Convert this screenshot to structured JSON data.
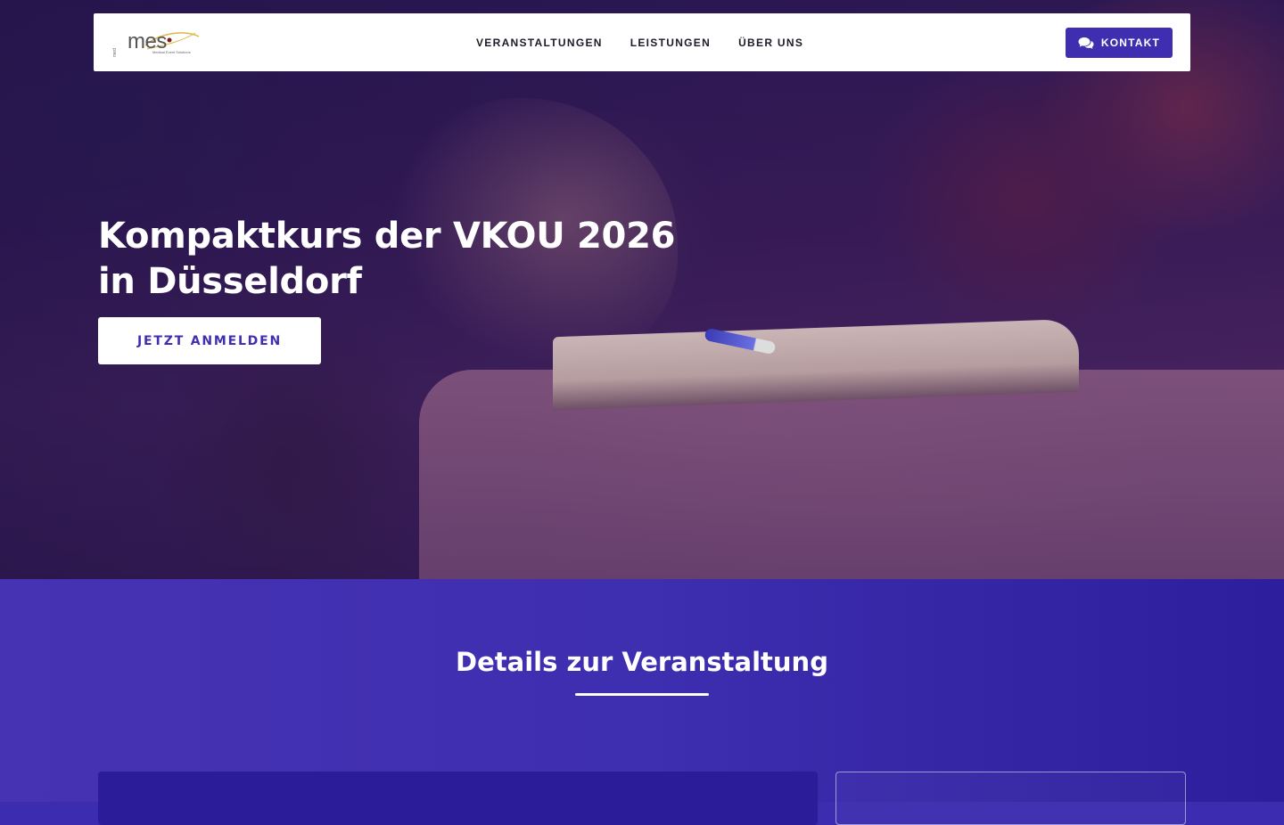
{
  "navbar": {
    "logo": {
      "word": "mes",
      "prefix": "med",
      "tagline": "Medical Event Solutions",
      "colors": {
        "swoosh": "#e0b64a",
        "dot": "#7a1a1a"
      }
    },
    "links": [
      {
        "label": "VERANSTALTUNGEN"
      },
      {
        "label": "LEISTUNGEN"
      },
      {
        "label": "ÜBER UNS"
      }
    ],
    "contact": {
      "label": "KONTAKT",
      "icon": "chat-bubbles-icon"
    }
  },
  "hero": {
    "title_line1": "Kompaktkurs der VKOU 2026",
    "title_line2": "in Düsseldorf",
    "cta_label": "JETZT ANMELDEN"
  },
  "details": {
    "title": "Details zur Veranstaltung"
  },
  "colors": {
    "accent": "#3f2fb0",
    "section_bg": "#3e2eb0",
    "text_light": "#ffffff"
  }
}
